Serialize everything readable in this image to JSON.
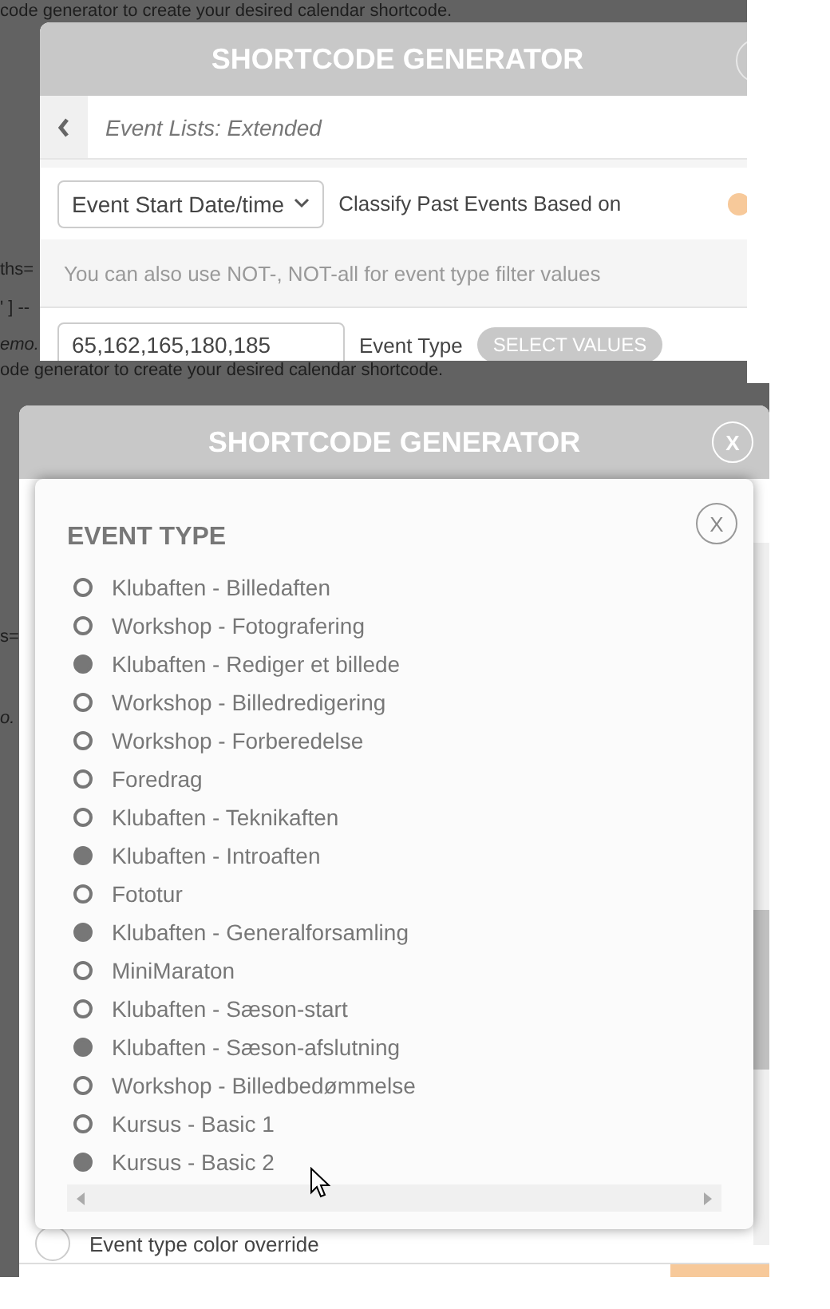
{
  "top_screen": {
    "backdrop_texts": [
      {
        "text": "code generator to create your desired calendar shortcode.",
        "italic": false
      },
      {
        "text": "ths=",
        "italic": false
      },
      {
        "text": "' ] --",
        "italic": false
      },
      {
        "text": "emo.",
        "italic": true
      },
      {
        "text": "ode generator to create your desired calendar shortcode.",
        "italic": false
      }
    ],
    "dialog": {
      "title": "SHORTCODE GENERATOR",
      "breadcrumb": "Event Lists: Extended",
      "select_value": "Event Start Date/time",
      "select_label": "Classify Past Events Based on",
      "note": "You can also use NOT-, NOT-all for event type filter values",
      "event_type_value": "65,162,165,180,185",
      "event_type_label": "Event Type",
      "select_values_button": "SELECT VALUES"
    }
  },
  "bottom_screen": {
    "backdrop_texts": [
      {
        "text": "s=",
        "italic": false
      },
      {
        "text": "o.",
        "italic": true
      }
    ],
    "dialog": {
      "title": "SHORTCODE GENERATOR",
      "close": "X",
      "footer_label": "Event type color override",
      "footer_toggle_on": false
    },
    "modal": {
      "title": "EVENT TYPE",
      "close": "X",
      "options": [
        {
          "label": "Klubaften - Billedaften",
          "selected": false
        },
        {
          "label": "Workshop - Fotografering",
          "selected": false
        },
        {
          "label": "Klubaften - Rediger et billede",
          "selected": true
        },
        {
          "label": "Workshop - Billedredigering",
          "selected": false
        },
        {
          "label": "Workshop - Forberedelse",
          "selected": false
        },
        {
          "label": "Foredrag",
          "selected": false
        },
        {
          "label": "Klubaften - Teknikaften",
          "selected": false
        },
        {
          "label": "Klubaften - Introaften",
          "selected": true
        },
        {
          "label": "Fototur",
          "selected": false
        },
        {
          "label": "Klubaften - Generalforsamling",
          "selected": true
        },
        {
          "label": "MiniMaraton",
          "selected": false
        },
        {
          "label": "Klubaften - Sæson-start",
          "selected": false
        },
        {
          "label": "Klubaften - Sæson-afslutning",
          "selected": true
        },
        {
          "label": "Workshop - Billedbedømmelse",
          "selected": false
        },
        {
          "label": "Kursus - Basic 1",
          "selected": false
        },
        {
          "label": "Kursus - Basic 2",
          "selected": true
        }
      ]
    }
  }
}
